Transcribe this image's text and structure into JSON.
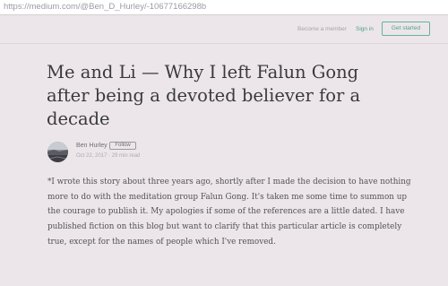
{
  "browser": {
    "url": "https://medium.com/@Ben_D_Hurley/-10677166298b"
  },
  "nav": {
    "become_member": "Become a member",
    "sign_in": "Sign in",
    "get_started": "Get started"
  },
  "article": {
    "title": "Me and Li — Why I left Falun Gong after being a devoted believer for a decade",
    "author": {
      "name": "Ben Hurley",
      "follow_label": "Follow",
      "avatar_icon": "author-avatar-photo"
    },
    "meta": "Oct 22, 2017 · 29 min read",
    "intro": "*I wrote this story about three years ago, shortly after I made the decision to have nothing more to do with the meditation group Falun Gong. It's taken me some time to summon up the courage to publish it. My apologies if some of the references are a little dated. I have published fiction on this blog but want to clarify that this particular article is completely true, except for the names of people which I've removed."
  },
  "colors": {
    "background": "#ece6ea",
    "accent": "#4fa28a",
    "title": "#3a3a3a",
    "body": "#525252"
  }
}
